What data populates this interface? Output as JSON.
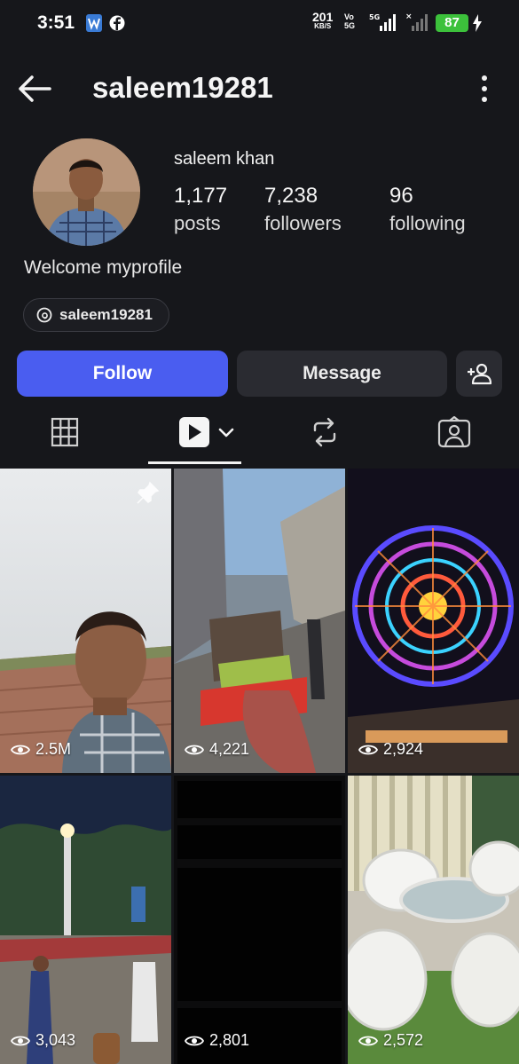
{
  "status_bar": {
    "time": "3:51",
    "net_speed": "201",
    "net_speed_unit": "KB/S",
    "volte_top": "Vo",
    "volte_bottom": "5G",
    "network": "5G",
    "battery": "87"
  },
  "header": {
    "username": "saleem19281"
  },
  "profile": {
    "display_name": "saleem khan",
    "stats": [
      {
        "value": "1,177",
        "label": "posts"
      },
      {
        "value": "7,238",
        "label": "followers"
      },
      {
        "value": "96",
        "label": "following"
      }
    ],
    "bio": "Welcome myprofile",
    "threads_handle": "saleem19281"
  },
  "actions": {
    "follow_label": "Follow",
    "message_label": "Message"
  },
  "tabs": [
    {
      "icon": "grid-icon",
      "active": false
    },
    {
      "icon": "reels-icon",
      "active": true
    },
    {
      "icon": "reposts-icon",
      "active": false
    },
    {
      "icon": "tagged-icon",
      "active": false
    }
  ],
  "posts": [
    {
      "views": "2.5M",
      "pinned": true
    },
    {
      "views": "4,221",
      "pinned": false
    },
    {
      "views": "2,924",
      "pinned": false
    },
    {
      "views": "3,043",
      "pinned": false
    },
    {
      "views": "2,801",
      "pinned": false
    },
    {
      "views": "2,572",
      "pinned": false
    }
  ],
  "colors": {
    "background": "#16171b",
    "accent": "#4a5df0",
    "button_secondary": "#2a2b31",
    "battery": "#3cc13b"
  }
}
